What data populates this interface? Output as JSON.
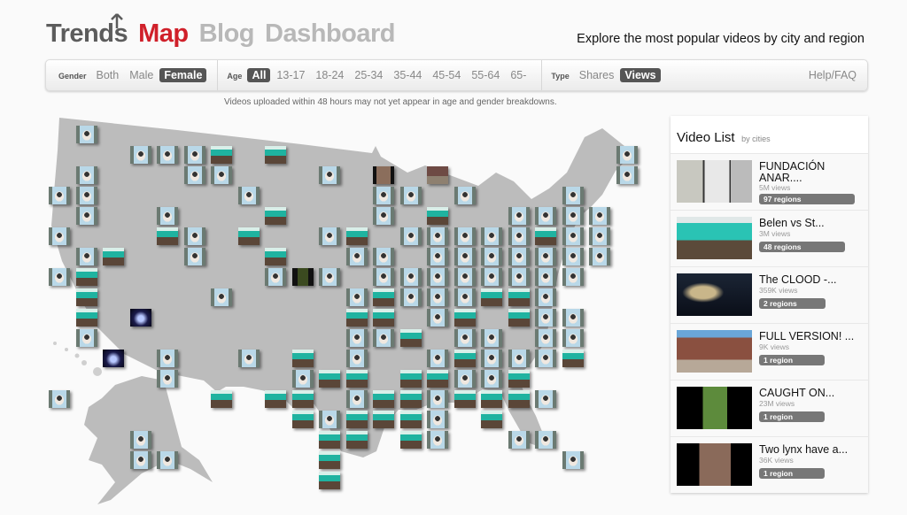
{
  "header": {
    "nav": [
      {
        "label": "Trends",
        "color": "#5c5c5c"
      },
      {
        "label": "Map",
        "color": "#d0202a"
      },
      {
        "label": "Blog",
        "color": "#b8b8b8"
      },
      {
        "label": "Dashboard",
        "color": "#b8b8b8"
      }
    ],
    "tagline": "Explore the most popular videos by city and region"
  },
  "filters": {
    "gender": {
      "label": "Gender",
      "options": [
        "Both",
        "Male",
        "Female"
      ],
      "selected": "Female"
    },
    "age": {
      "label": "Age",
      "options": [
        "All",
        "13-17",
        "18-24",
        "25-34",
        "35-44",
        "45-54",
        "55-64",
        "65-"
      ],
      "selected": "All"
    },
    "type": {
      "label": "Type",
      "options": [
        "Shares",
        "Views"
      ],
      "selected": "Views"
    },
    "help": "Help/FAQ"
  },
  "notice": "Videos uploaded within 48 hours may not yet appear in age and gender breakdowns.",
  "map": {
    "grid_rows": [
      "1f",
      "3f 4f 5f 6p 8p 21f",
      "1f 5f 6f 10f 12r 14s 21f",
      "0f 1f 7f 12f 13f 15f 19f",
      "1f 4f 8p 12f 14p 17f 18f 19f 20f",
      "0f 4p 5f 7p 10f 11p 13f 14f 15f 16f 17f 18p 19f 20f",
      "1f 2p 5f 8p 11f 12f 14f 15f 16f 17f 18f 19f 20f",
      "0f 1p 8f 9b 10f 12f 13f 14f 15f 16f 17f 18f 19f",
      "1p 6f 11f 12p 13f 14f 15f 16p 17p 18f",
      "1p 3c 11p 12p 14f 15p 17p 18f 19f",
      "1f 11f 12f 13p 15f 16f 18f 19f",
      "2c 4f 7f 9p 11f 14f 15p 16f 17f 18f 19p",
      "4f 9f 10p 11p 13p 14p 15f 16f 17p",
      "0f 6p 8p 9p 11f 12p 13p 14f 15p 16p 17p 18f",
      "9p 10f 11p 12p 13p 14f 16p",
      "3f 10p 11p 13p 14f 17f 18f",
      "3f 4f 10p 19f",
      "10p"
    ],
    "thumbnail_legend": {
      "f": "FUNDACIÓN ANAR....",
      "p": "Belen vs St...",
      "c": "The CLOOD -...",
      "s": "FULL VERSION! ...",
      "b": "CAUGHT ON...",
      "r": "Two lynx have a..."
    }
  },
  "video_list": {
    "title": "Video List",
    "subtitle": "by cities",
    "items": [
      {
        "title": "FUNDACIÓN ANAR....",
        "views": "5M views",
        "regions": "97 regions",
        "regions_count": 97
      },
      {
        "title": "Belen vs St...",
        "views": "3M views",
        "regions": "48 regions",
        "regions_count": 48
      },
      {
        "title": "The CLOOD -...",
        "views": "359K views",
        "regions": "2 regions",
        "regions_count": 2
      },
      {
        "title": "FULL VERSION! ...",
        "views": "9K views",
        "regions": "1 region",
        "regions_count": 1
      },
      {
        "title": "CAUGHT ON...",
        "views": "23M views",
        "regions": "1 region",
        "regions_count": 1
      },
      {
        "title": "Two lynx have a...",
        "views": "36K views",
        "regions": "1 region",
        "regions_count": 1
      }
    ]
  }
}
